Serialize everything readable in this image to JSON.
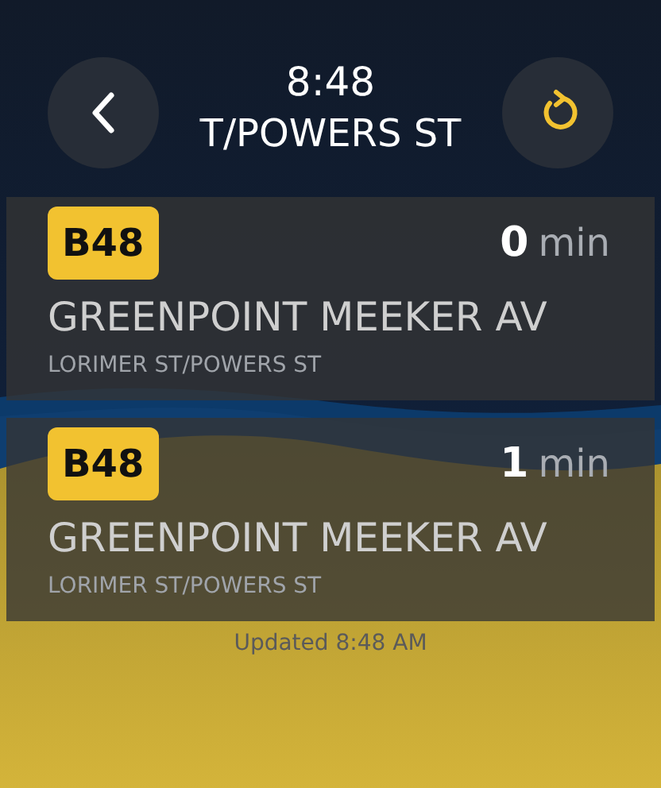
{
  "header": {
    "time": "8:48",
    "subtitle": "T/POWERS ST"
  },
  "arrivals": [
    {
      "route": "B48",
      "minutes": "0",
      "unit": "min",
      "destination": "GREENPOINT MEEKER AV",
      "stop": "LORIMER ST/POWERS ST"
    },
    {
      "route": "B48",
      "minutes": "1",
      "unit": "min",
      "destination": "GREENPOINT MEEKER AV",
      "stop": "LORIMER ST/POWERS ST"
    }
  ],
  "updated": "Updated 8:48 AM"
}
